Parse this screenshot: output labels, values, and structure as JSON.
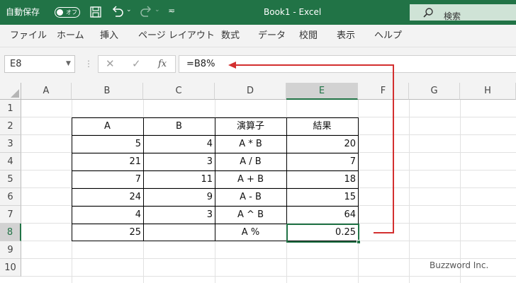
{
  "titlebar": {
    "autosave_label": "自動保存",
    "autosave_state": "オフ",
    "title": "Book1  -  Excel",
    "search_placeholder": "検索"
  },
  "ribbon": {
    "tabs": [
      "ファイル",
      "ホーム",
      "挿入",
      "ページ レイアウト",
      "数式",
      "データ",
      "校閲",
      "表示",
      "ヘルプ"
    ]
  },
  "formula_bar": {
    "name_box": "E8",
    "fx": "fx",
    "formula": "=B8%"
  },
  "sheet": {
    "columns": [
      "A",
      "B",
      "C",
      "D",
      "E",
      "F",
      "G",
      "H"
    ],
    "rows": [
      "1",
      "2",
      "3",
      "4",
      "5",
      "6",
      "7",
      "8",
      "9",
      "10"
    ],
    "selected_cell": "E8",
    "table": {
      "header": [
        "A",
        "B",
        "演算子",
        "結果"
      ],
      "rows": [
        [
          "5",
          "4",
          "A * B",
          "20"
        ],
        [
          "21",
          "3",
          "A / B",
          "7"
        ],
        [
          "7",
          "11",
          "A + B",
          "18"
        ],
        [
          "24",
          "9",
          "A - B",
          "15"
        ],
        [
          "4",
          "3",
          "A ^ B",
          "64"
        ],
        [
          "25",
          "",
          "A %",
          "0.25"
        ]
      ]
    }
  },
  "watermark": "Buzzword Inc.",
  "colors": {
    "excel_green": "#217346",
    "arrow": "#d32f2f"
  }
}
